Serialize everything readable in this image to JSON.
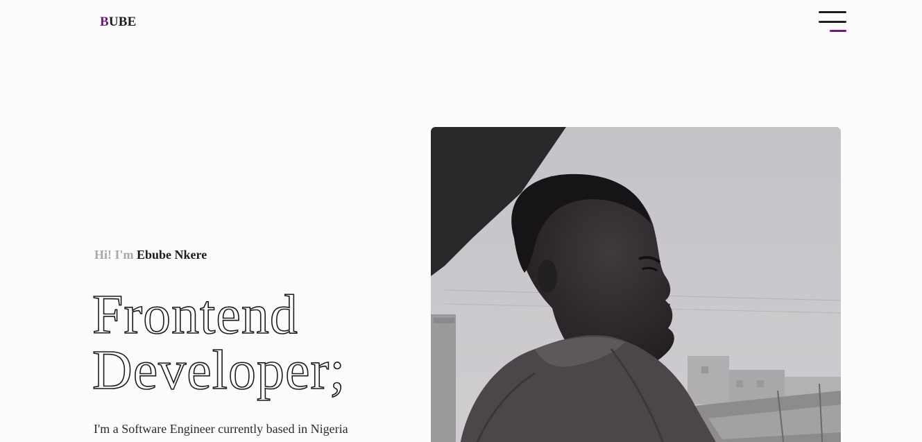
{
  "header": {
    "logo_accent": "B",
    "logo_rest": "UBE",
    "menu_icon": "hamburger-menu-icon"
  },
  "hero": {
    "greeting_prefix": "Hi! I'm",
    "name": "Ebube Nkere",
    "headline_line1": "Frontend",
    "headline_line2": "Developer;",
    "intro": "I'm a Software Engineer currently based in Nigeria"
  },
  "colors": {
    "accent": "#6a1b79",
    "text": "#1b1b1b",
    "muted": "#a8a8a8",
    "background": "#fcfcfc"
  }
}
